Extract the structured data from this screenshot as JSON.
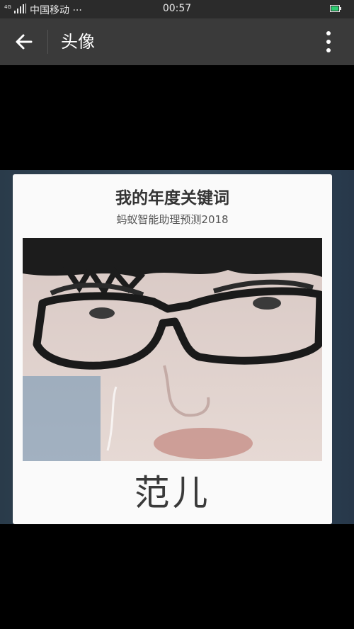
{
  "status_bar": {
    "signal_text": "4G",
    "carrier": "中国移动 ···",
    "time": "00:57",
    "battery_color": "#2ecc71"
  },
  "app_bar": {
    "back_icon": "arrow-left-icon",
    "title": "头像",
    "more_icon": "more-vertical-icon"
  },
  "card": {
    "heading": "我的年度关键词",
    "subheading": "蚂蚁智能助理预测2018",
    "keyword": "范儿"
  },
  "colors": {
    "statusbar_bg": "#2b2b2b",
    "appbar_bg": "#3a3a3a",
    "page_bg": "#000000",
    "card_bg": "#fafafa"
  }
}
